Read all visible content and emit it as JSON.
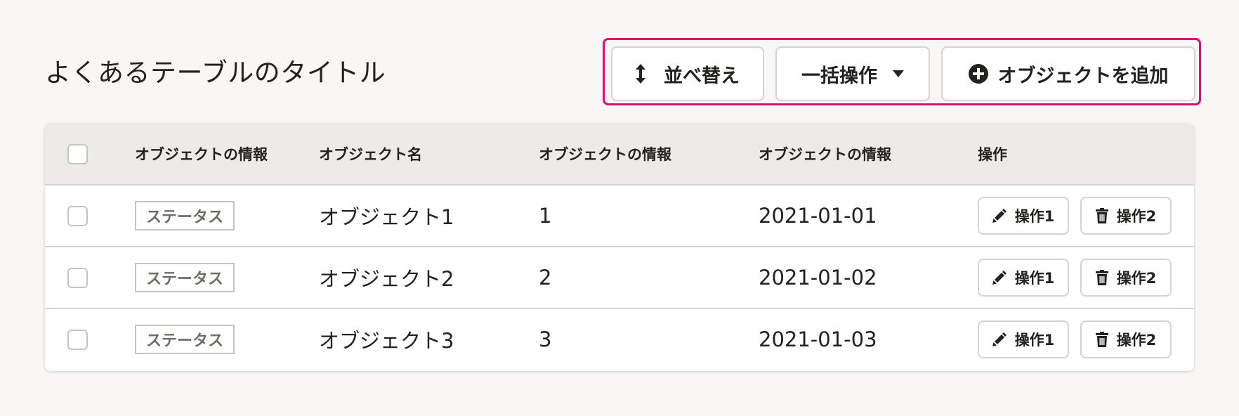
{
  "page": {
    "title": "よくあるテーブルのタイトル"
  },
  "toolbar": {
    "sort_label": "並べ替え",
    "bulk_label": "一括操作",
    "add_label": "オブジェクトを追加",
    "highlight_color": "#e2106d",
    "icons": [
      "sort-icon",
      "caret-down-icon",
      "add-circle-icon"
    ]
  },
  "table": {
    "headers": [
      "オブジェクトの情報",
      "オブジェクト名",
      "オブジェクトの情報",
      "オブジェクトの情報",
      "操作"
    ],
    "rows": [
      {
        "status": "ステータス",
        "name": "オブジェクト1",
        "info": "1",
        "date": "2021-01-01",
        "action1": "操作1",
        "action2": "操作2"
      },
      {
        "status": "ステータス",
        "name": "オブジェクト2",
        "info": "2",
        "date": "2021-01-02",
        "action1": "操作1",
        "action2": "操作2"
      },
      {
        "status": "ステータス",
        "name": "オブジェクト3",
        "info": "3",
        "date": "2021-01-03",
        "action1": "操作1",
        "action2": "操作2"
      }
    ],
    "action_icons": [
      "pencil-icon",
      "trash-icon"
    ]
  }
}
